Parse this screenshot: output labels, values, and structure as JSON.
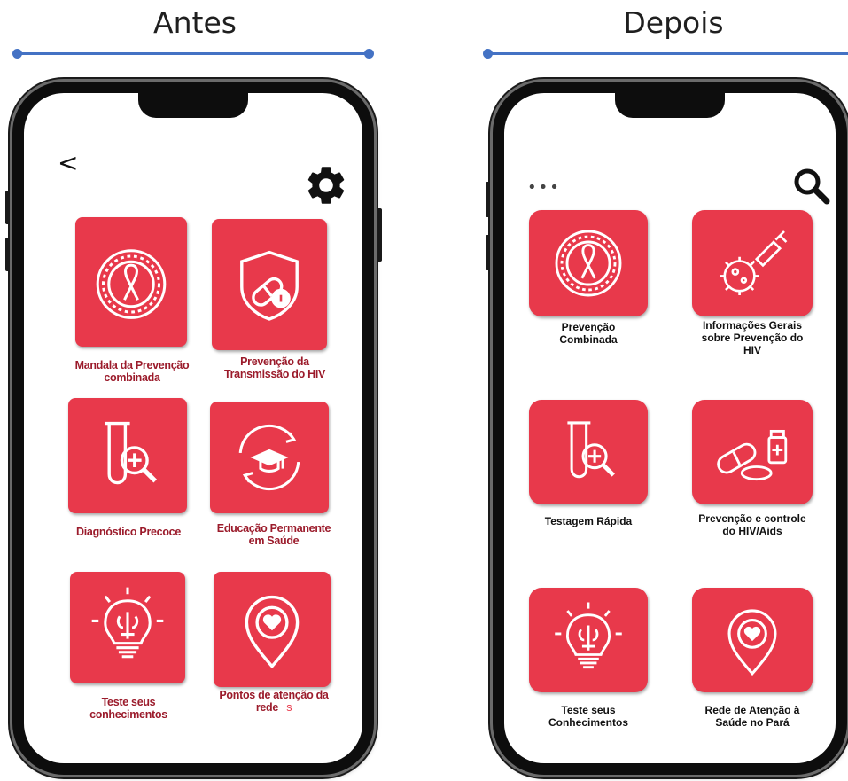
{
  "headings": {
    "before": "Antes",
    "after": "Depois"
  },
  "before_screen": {
    "back_label": "<",
    "tiles": [
      {
        "label": "Mandala da Prevenção combinada",
        "icon": "ribbon-mandala-icon"
      },
      {
        "label": "Prevenção da Transmissão do HIV",
        "icon": "shield-pill-icon"
      },
      {
        "label": "Diagnóstico Precoce",
        "icon": "test-tube-magnifier-icon"
      },
      {
        "label": "Educação Permanente em Saúde",
        "icon": "graduation-cap-cycle-icon"
      },
      {
        "label": "Teste seus conhecimentos",
        "icon": "lightbulb-brain-icon"
      },
      {
        "label": "Pontos de atenção da rede",
        "extra": "s",
        "icon": "heart-location-pin-icon"
      }
    ]
  },
  "after_screen": {
    "menu_label": "•••",
    "tiles": [
      {
        "label": "Prevenção Combinada",
        "icon": "ribbon-mandala-icon"
      },
      {
        "label": "Informações Gerais sobre Prevenção do HIV",
        "icon": "virus-syringe-icon"
      },
      {
        "label": "Testagem Rápida",
        "icon": "test-tube-magnifier-icon"
      },
      {
        "label": "Prevenção e controle do HIV/Aids",
        "icon": "pills-bottle-icon"
      },
      {
        "label": "Teste seus Conhecimentos",
        "icon": "lightbulb-brain-icon"
      },
      {
        "label": "Rede de Atenção à Saúde no Pará",
        "icon": "heart-location-pin-icon"
      }
    ]
  },
  "colors": {
    "tile": "#e8394b",
    "old_label": "#9b1b2b",
    "divider": "#4472c4"
  }
}
